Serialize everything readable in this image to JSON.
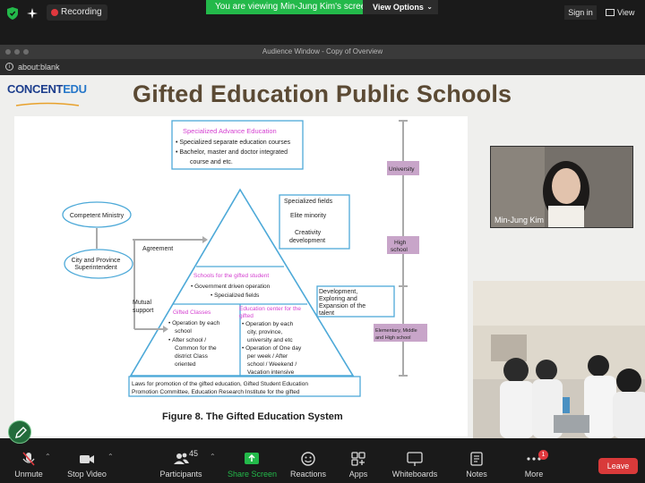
{
  "top_bar": {
    "recording_label": "Recording",
    "viewing_banner": "You are viewing Min-Jung Kim's screen",
    "view_options_label": "View Options",
    "sign_in_label": "Sign in",
    "view_label": "View"
  },
  "shared_window": {
    "title": "Audience Window - Copy of Overview",
    "address": "about:blank"
  },
  "slide": {
    "logo_text_a": "CONCENT",
    "logo_text_b": "EDU",
    "title": "Gifted Education Public Schools",
    "figure": {
      "top_box_title": "Specialized Advance Education",
      "top_box_items": [
        "Specialized separate education courses",
        "Bachelor, master and doctor integrated",
        "course and etc."
      ],
      "competent_ministry": "Competent Ministry",
      "city_province_line1": "City and Province",
      "city_province_line2": "Superintendent",
      "agreement": "Agreement",
      "mutual_line1": "Mutual",
      "mutual_line2": "support",
      "spec_fields_title": "Specialized fields",
      "elite_minority": "Elite minority",
      "creativity_line1": "Creativity",
      "creativity_line2": "development",
      "schools_gifted": "Schools for the gifted student",
      "gov_driven": "Government driven operation",
      "spec_fields": "Specialized fields",
      "gifted_classes": "Gifted Classes",
      "gc_items": [
        "Operation by each",
        "school",
        "After school /",
        "Common for the",
        "district Class",
        "oriented"
      ],
      "edu_center_line1": "Education center for the",
      "edu_center_line2": "gifted",
      "ec_items": [
        "Operation by each",
        "city, province,",
        "university and etc",
        "Operation of One day",
        "per week / After",
        "school / Weekend /",
        "Vacation intensive"
      ],
      "dev_line1": "Development,",
      "dev_line2": "Exploring and",
      "dev_line3": "Expansion of the",
      "dev_line4": "talent",
      "university": "University",
      "high_line1": "High",
      "high_line2": "school",
      "elem_line1": "Elementary, Middle",
      "elem_line2": "and High school",
      "laws_line1": "Laws for promotion of the gifted education, Gifted Student Education",
      "laws_line2": "Promotion Committee, Education Research Institute for the gifted",
      "caption": "Figure 8. The Gifted Education System"
    }
  },
  "webcam": {
    "name": "Min-Jung Kim"
  },
  "toolbar": {
    "unmute": "Unmute",
    "stop_video": "Stop Video",
    "participants": "Participants",
    "participant_count": "45",
    "share_screen": "Share Screen",
    "reactions": "Reactions",
    "apps": "Apps",
    "whiteboards": "Whiteboards",
    "notes": "Notes",
    "more": "More",
    "more_badge": "1",
    "leave": "Leave"
  },
  "colors": {
    "viewing_green": "#23b94a",
    "share_green": "#23b94a",
    "leave_red": "#d93a3a",
    "title_brown": "#5b4a34",
    "figure_pink": "#d43fd0",
    "box_blue": "#4da9d8"
  }
}
